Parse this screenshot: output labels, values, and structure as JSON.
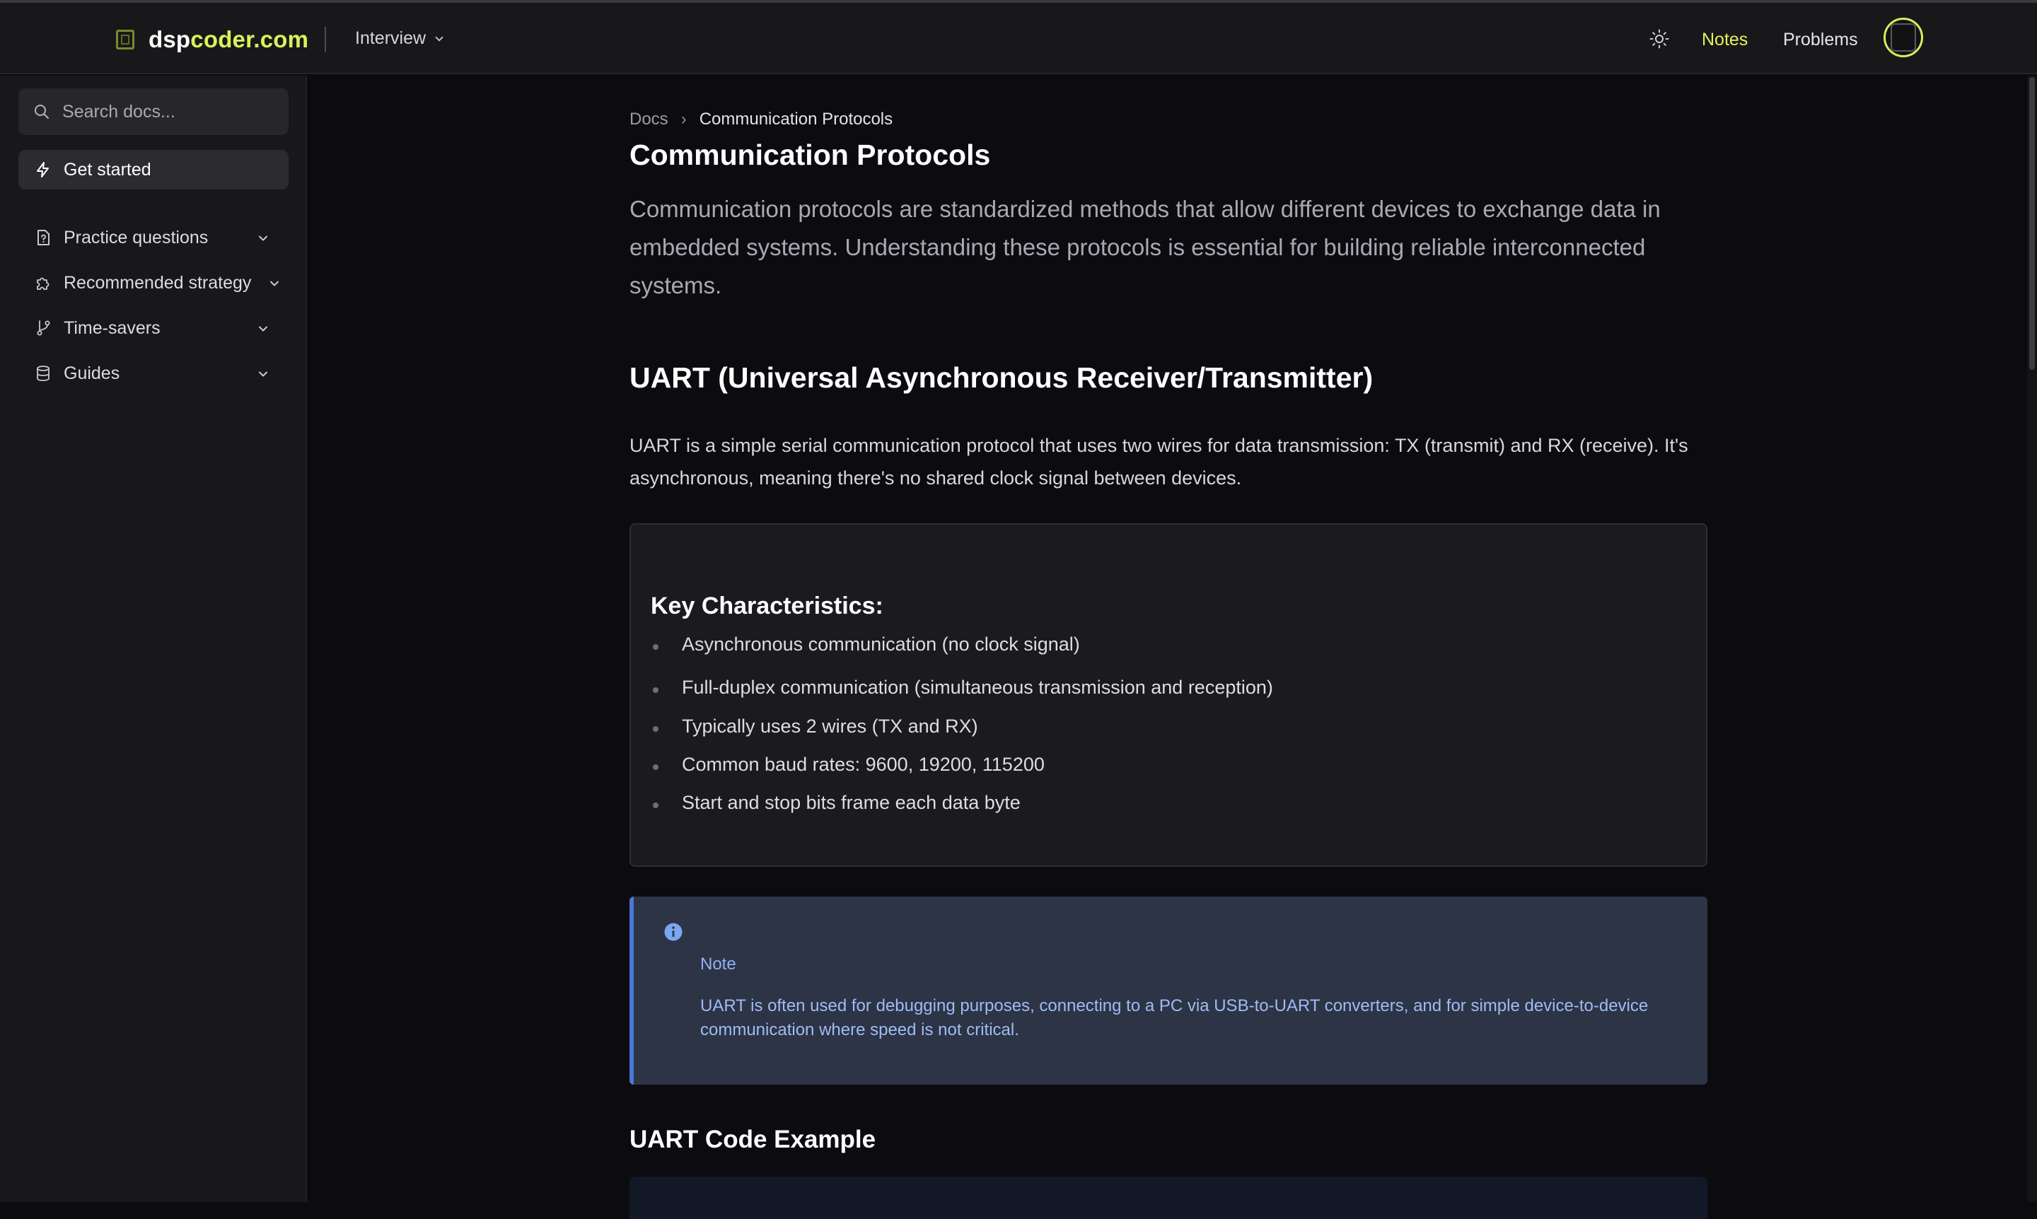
{
  "header": {
    "logo_part1": "dsp",
    "logo_part2": "coder.com",
    "interview_label": "Interview",
    "nav_notes": "Notes",
    "nav_problems": "Problems",
    "colors": {
      "accent": "#d9f25a",
      "background": "#18181b"
    }
  },
  "sidebar": {
    "search_placeholder": "Search docs...",
    "get_started": "Get started",
    "items": [
      {
        "label": "Practice questions",
        "icon": "file-question-icon"
      },
      {
        "label": "Recommended strategy",
        "icon": "puzzle-icon"
      },
      {
        "label": "Time-savers",
        "icon": "git-branch-icon"
      },
      {
        "label": "Guides",
        "icon": "database-icon"
      }
    ]
  },
  "main": {
    "breadcrumb": {
      "root": "Docs",
      "separator": "›",
      "current": "Communication Protocols"
    },
    "title": "Communication Protocols",
    "lead": "Communication protocols are standardized methods that allow different devices to exchange data in embedded systems. Understanding these protocols is essential for building reliable interconnected systems.",
    "uart_heading": "UART (Universal Asynchronous Receiver/Transmitter)",
    "uart_paragraph": "UART is a simple serial communication protocol that uses two wires for data transmission: TX (transmit) and RX (receive). It's asynchronous, meaning there's no shared clock signal between devices.",
    "characteristics": {
      "title": "Key Characteristics:",
      "items": [
        "Asynchronous communication (no clock signal)",
        "Full-duplex communication (simultaneous transmission and reception)",
        "Typically uses 2 wires (TX and RX)",
        "Common baud rates: 9600, 19200, 115200",
        "Start and stop bits frame each data byte"
      ]
    },
    "note": {
      "label": "Note",
      "text": "UART is often used for debugging purposes, connecting to a PC via USB-to-UART converters, and for simple device-to-device communication where speed is not critical."
    },
    "code_example_heading": "UART Code Example"
  }
}
